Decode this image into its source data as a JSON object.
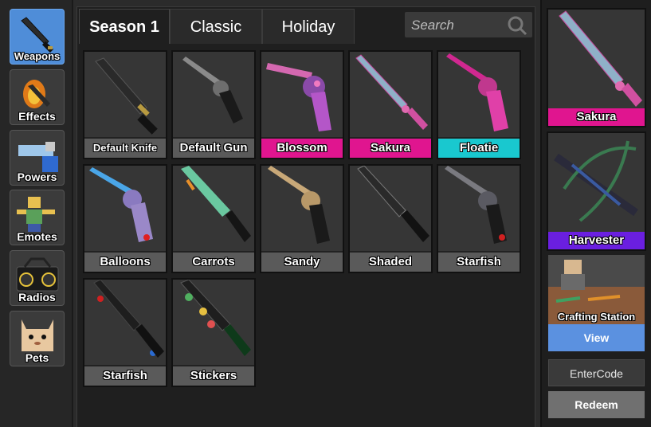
{
  "sidebar": {
    "items": [
      {
        "label": "Weapons",
        "icon": "knife-icon",
        "active": true
      },
      {
        "label": "Effects",
        "icon": "flame-knife-icon",
        "active": false
      },
      {
        "label": "Powers",
        "icon": "powers-icon",
        "active": false
      },
      {
        "label": "Emotes",
        "icon": "emote-avatar-icon",
        "active": false
      },
      {
        "label": "Radios",
        "icon": "boombox-icon",
        "active": false
      },
      {
        "label": "Pets",
        "icon": "cat-pet-icon",
        "active": false
      }
    ]
  },
  "tabs": [
    {
      "label": "Season 1",
      "active": true
    },
    {
      "label": "Classic",
      "active": false
    },
    {
      "label": "Holiday",
      "active": false
    }
  ],
  "search": {
    "placeholder": "Search",
    "value": ""
  },
  "items": [
    {
      "name": "Default Knife",
      "kind": "knife",
      "label_color": "#5a5a5a"
    },
    {
      "name": "Default Gun",
      "kind": "gun",
      "label_color": "#5a5a5a"
    },
    {
      "name": "Blossom",
      "kind": "gun",
      "label_color": "#e0158f"
    },
    {
      "name": "Sakura",
      "kind": "knife",
      "label_color": "#e0158f"
    },
    {
      "name": "Floatie",
      "kind": "gun",
      "label_color": "#19c8cf"
    },
    {
      "name": "Balloons",
      "kind": "gun",
      "label_color": "#5a5a5a"
    },
    {
      "name": "Carrots",
      "kind": "knife",
      "label_color": "#5a5a5a"
    },
    {
      "name": "Sandy",
      "kind": "gun",
      "label_color": "#5a5a5a"
    },
    {
      "name": "Shaded",
      "kind": "knife",
      "label_color": "#5a5a5a"
    },
    {
      "name": "Starfish",
      "kind": "gun",
      "label_color": "#5a5a5a"
    },
    {
      "name": "Starfish",
      "kind": "knife",
      "label_color": "#5a5a5a"
    },
    {
      "name": "Stickers",
      "kind": "knife",
      "label_color": "#5a5a5a"
    }
  ],
  "featured": [
    {
      "name": "Sakura",
      "label_color": "#e0158f"
    },
    {
      "name": "Harvester",
      "label_color": "#6a1fe0"
    }
  ],
  "crafting": {
    "label": "Crafting Station",
    "view_label": "View"
  },
  "code": {
    "enter_label": "EnterCode",
    "redeem_label": "Redeem"
  },
  "colors": {
    "accent_blue": "#4f8dd8",
    "view_button": "#5b91e0"
  }
}
